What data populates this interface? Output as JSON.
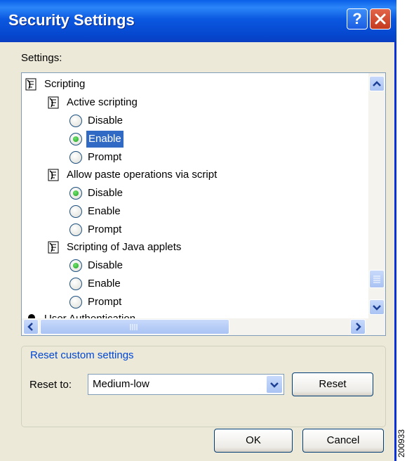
{
  "window": {
    "title": "Security Settings"
  },
  "titlebar": {
    "help_label": "?"
  },
  "settings_label": "Settings:",
  "tree": {
    "items": [
      {
        "label": "Scripting"
      },
      {
        "label": "Active scripting"
      },
      {
        "label": "Disable",
        "selected": false
      },
      {
        "label": "Enable",
        "selected": true
      },
      {
        "label": "Prompt",
        "selected": false
      },
      {
        "label": "Allow paste operations via script"
      },
      {
        "label": "Disable",
        "selected": true
      },
      {
        "label": "Enable",
        "selected": false
      },
      {
        "label": "Prompt",
        "selected": false
      },
      {
        "label": "Scripting of Java applets"
      },
      {
        "label": "Disable",
        "selected": true
      },
      {
        "label": "Enable",
        "selected": false
      },
      {
        "label": "Prompt",
        "selected": false
      },
      {
        "label": "User Authentication"
      }
    ]
  },
  "reset_group": {
    "legend": "Reset custom settings",
    "reset_to_label": "Reset to:",
    "selected_option": "Medium-low",
    "reset_button": "Reset"
  },
  "buttons": {
    "ok": "OK",
    "cancel": "Cancel"
  },
  "figure_id": "200933",
  "colors": {
    "titlebar": "#0A5FE8",
    "selection": "#316AC5",
    "dialog_bg": "#ECE9D8",
    "radio_on": "#21A121"
  }
}
